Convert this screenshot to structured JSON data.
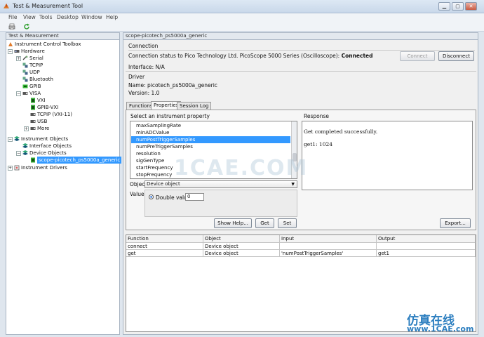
{
  "window": {
    "title": "Test & Measurement Tool"
  },
  "menu": [
    "File",
    "View",
    "Tools",
    "Desktop",
    "Window",
    "Help"
  ],
  "tree": {
    "header": "Test & Measurement",
    "nodes": [
      {
        "label": "Instrument Control Toolbox",
        "level": 0,
        "icon": "toolbox-icon"
      },
      {
        "label": "Hardware",
        "level": 1,
        "icon": "hardware-icon",
        "expanded": true
      },
      {
        "label": "Serial",
        "level": 2,
        "icon": "serial-icon",
        "expanded": false
      },
      {
        "label": "TCPIP",
        "level": 2,
        "icon": "tcpip-icon"
      },
      {
        "label": "UDP",
        "level": 2,
        "icon": "udp-icon"
      },
      {
        "label": "Bluetooth",
        "level": 2,
        "icon": "bluetooth-icon"
      },
      {
        "label": "GPIB",
        "level": 2,
        "icon": "gpib-icon"
      },
      {
        "label": "VISA",
        "level": 2,
        "icon": "visa-icon",
        "expanded": true
      },
      {
        "label": "VXI",
        "level": 3,
        "icon": "vxi-icon"
      },
      {
        "label": "GPIB-VXI",
        "level": 3,
        "icon": "gpib-vxi-icon"
      },
      {
        "label": "TCPIP (VXI-11)",
        "level": 3,
        "icon": "tcpip-vxi-icon"
      },
      {
        "label": "USB",
        "level": 3,
        "icon": "usb-icon"
      },
      {
        "label": "More",
        "level": 3,
        "icon": "more-icon",
        "expanded": false
      },
      {
        "label": "Instrument Objects",
        "level": 1,
        "icon": "instrument-objects-icon",
        "expanded": true
      },
      {
        "label": "Interface Objects",
        "level": 2,
        "icon": "interface-objects-icon"
      },
      {
        "label": "Device Objects",
        "level": 2,
        "icon": "device-objects-icon",
        "expanded": true
      },
      {
        "label": "scope-picotech_ps5000a_generic",
        "level": 3,
        "icon": "device-icon",
        "selected": true
      },
      {
        "label": "Instrument Drivers",
        "level": 1,
        "icon": "instrument-drivers-icon",
        "expanded": false
      }
    ]
  },
  "main": {
    "header": "scope-picotech_ps5000a_generic",
    "connection": {
      "section_title": "Connection",
      "status_prefix": "Connection status to Pico Technology Ltd. PicoScope 5000 Series (Oscilloscope):",
      "status_value": "Connected",
      "connect_label": "Connect",
      "disconnect_label": "Disconnect",
      "interface": "Interface: N/A"
    },
    "driver": {
      "section_title": "Driver",
      "name": "Name:   picotech_ps5000a_generic",
      "version": "Version: 1.0"
    },
    "tabs": [
      "Functions",
      "Properties",
      "Session Log"
    ],
    "active_tab": "Properties",
    "properties": {
      "list_title": "Select an instrument property",
      "items": [
        "maxSamplingRate",
        "minADCValue",
        "numPostTriggerSamples",
        "numPreTriggerSamples",
        "resolution",
        "sigGenType",
        "startFrequency",
        "stopFrequency"
      ],
      "selected_index": 2,
      "object_label": "Object:",
      "object_value": "Device object",
      "value_label": "Value:",
      "double_label": "Double value:",
      "double_value": "0"
    },
    "response": {
      "title": "Response",
      "line1": "Get completed successfully.",
      "line2": "get1: 1024"
    },
    "buttons": {
      "show_help": "Show Help...",
      "get": "Get",
      "set": "Set",
      "export": "Export..."
    },
    "session_table": {
      "columns": [
        "Function",
        "Object",
        "Input",
        "Output"
      ],
      "rows": [
        [
          "connect",
          "Device object",
          "",
          ""
        ],
        [
          "get",
          "Device object",
          "'numPostTriggerSamples'",
          "get1"
        ]
      ]
    }
  },
  "watermark": {
    "main": "1CAE.COM",
    "cn": "仿真在线",
    "url": "www.1CAE.com"
  },
  "colors": {
    "selection": "#3399ff",
    "title_bar": "#c9d8ea",
    "watermark_blue": "#2d7fc0"
  }
}
